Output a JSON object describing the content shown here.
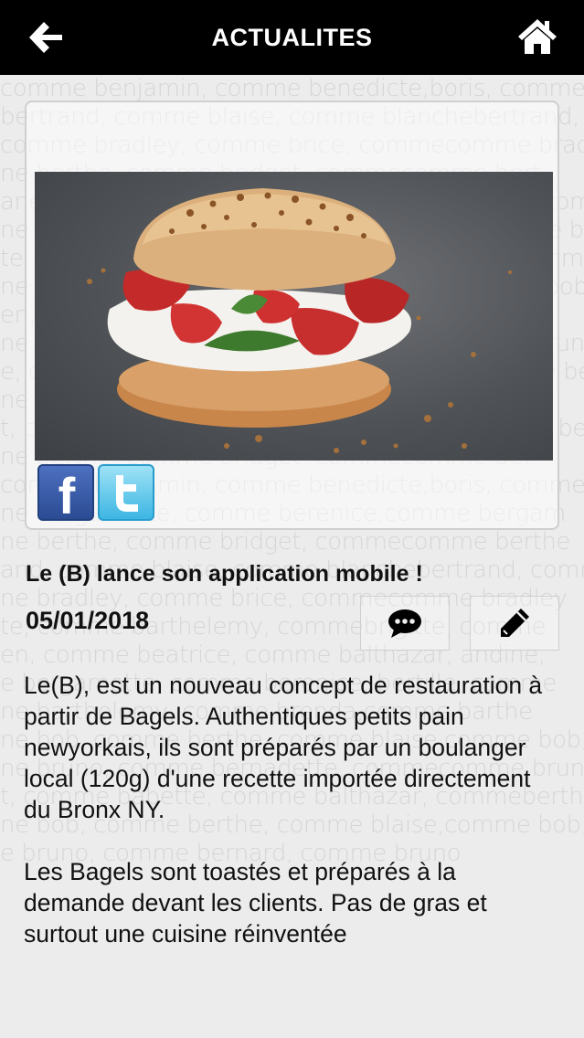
{
  "header": {
    "title": "ACTUALITES"
  },
  "background_pattern": [
    "comme benjamin, comme benedicte,boris, comme be",
    "bertrand, comme blaise, comme blanchebertrand, comme",
    "comme bradley, comme brice, commecomme brad",
    "ne berthe, comme bridget, commecomme bert",
    "ane, comme blaise, comme berengere, commecomme",
    "ne bradley, comme brice, comme bruno, comme ben",
    "te, comme barthelemy, comme bernadette, comme",
    "ne bob, comme berthe, comme blaise, comme bob, comm",
    "en, comme beatrice, comme balthazar, comme",
    "ne bruno, comme bernadette, commecomme bruno, com",
    "e, comme bergamotte, comme berenice,comme be",
    "ne berthe, comme bridget, commecomme ber",
    "t, comme bergamotte, comme berenice,comme be",
    "ne berthe, comme bridget, commecomme ber",
    "comme benjamin, comme benedicte,boris, comme be",
    "ne bergamotte, comme berenice,comme bergam",
    "ne berthe, comme bridget, commecomme berthe",
    "and, comme blaise, comme blanchebertrand, comme",
    "ne bradley, comme brice, commecomme bradley",
    "te, comme barthelemy, commebrigitte, comme",
    "en, comme beatrice, comme balthazar, andine,",
    "e bergamotte, comme berenice, bertille, comme",
    "ne bartholomy, comme brenda,comme barthe",
    "ne bob, comme berthe, comme blaise,comme bob, comm",
    "ne bruno, comme bernadette, commecomme bruno, com",
    "t, comme babette, comme balthazar, commeberthe",
    "ne bob, comme berthe, comme blaise,comme bob, comm",
    "e bruno, comme bernard, comme bruno"
  ],
  "social": {
    "facebook": "f"
  },
  "article": {
    "title": "Le (B) lance son application mobile !",
    "date": "05/01/2018",
    "paragraphs": [
      "Le(B), est un nouveau concept de restauration à partir de Bagels. Authentiques petits pain newyorkais, ils sont préparés par un boulanger local (120g) d'une recette importée directement du Bronx NY.",
      "Les Bagels sont toastés et préparés à la demande devant les clients. Pas de gras et surtout une cuisine réinventée"
    ]
  },
  "icons": {
    "back": "back-arrow-icon",
    "home": "home-icon",
    "comment": "comment-icon",
    "edit": "pencil-icon"
  },
  "colors": {
    "header_bg": "#000000",
    "page_bg": "#ececec",
    "facebook": "#3b5998",
    "twitter": "#55acee"
  }
}
